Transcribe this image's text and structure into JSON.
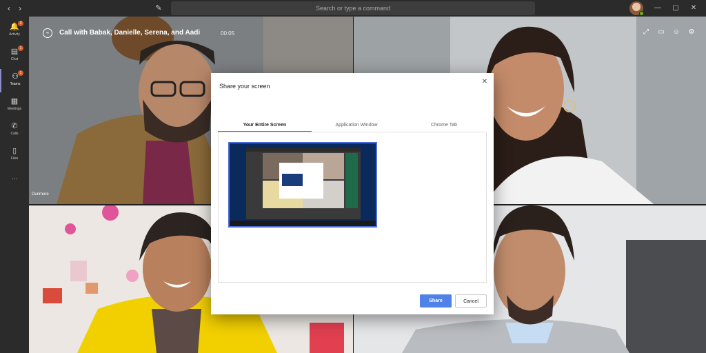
{
  "titlebar": {
    "search_placeholder": "Search or type a command",
    "back_icon": "chevron-left-icon",
    "forward_icon": "chevron-right-icon",
    "compose_icon": "compose-icon"
  },
  "rail": {
    "items": [
      {
        "label": "Activity",
        "icon": "bell-icon",
        "badge": "3"
      },
      {
        "label": "Chat",
        "icon": "chat-icon",
        "badge": "1"
      },
      {
        "label": "Teams",
        "icon": "teams-icon",
        "badge": "1"
      },
      {
        "label": "Meetings",
        "icon": "calendar-icon",
        "badge": ""
      },
      {
        "label": "Calls",
        "icon": "phone-icon",
        "badge": ""
      },
      {
        "label": "Files",
        "icon": "file-icon",
        "badge": ""
      },
      {
        "label": "...",
        "icon": "more-icon",
        "badge": ""
      }
    ],
    "active_index": 2
  },
  "call": {
    "title": "Call with Babak, Danielle, Serena, and Aadi",
    "duration": "00:05",
    "participant_name": "Dunmore"
  },
  "dialog": {
    "title": "Share your screen",
    "tabs": [
      "Your Entire Screen",
      "Application Window",
      "Chrome Tab"
    ],
    "active_tab": 0,
    "share_label": "Share",
    "cancel_label": "Cancel"
  },
  "colors": {
    "accent": "#4b6cd6",
    "share_button": "#4f82e8",
    "rail_bg": "#2b2b2b",
    "badge": "#d45a2c",
    "presence": "#6bb700"
  }
}
